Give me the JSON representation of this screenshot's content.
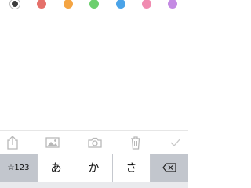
{
  "palette": {
    "colors": [
      {
        "name": "black",
        "hex": "#3a3a3a",
        "selected": true
      },
      {
        "name": "red",
        "hex": "#e5706a",
        "selected": false
      },
      {
        "name": "orange",
        "hex": "#f4a442",
        "selected": false
      },
      {
        "name": "green",
        "hex": "#6ccf6e",
        "selected": false
      },
      {
        "name": "blue",
        "hex": "#4aa3e8",
        "selected": false
      },
      {
        "name": "pink",
        "hex": "#f08bb0",
        "selected": false
      },
      {
        "name": "purple",
        "hex": "#c48ae3",
        "selected": false
      }
    ]
  },
  "note": {
    "text": ""
  },
  "toolbar": {
    "icons": [
      "share-icon",
      "image-icon",
      "camera-icon",
      "trash-icon",
      "checkmark-icon"
    ],
    "icon_color": "#b8b8b8"
  },
  "keyboard": {
    "keys": {
      "mode": "☆123",
      "a": "あ",
      "ka": "か",
      "sa": "さ"
    },
    "backspace_icon": "backspace-icon"
  }
}
